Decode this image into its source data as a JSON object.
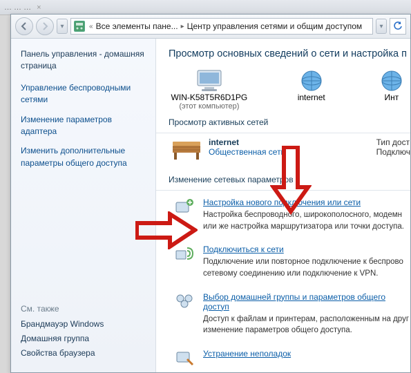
{
  "tabbar": {
    "ghost": "… … …"
  },
  "address": {
    "seg1": "Все элементы пане...",
    "seg2": "Центр управления сетями и общим доступом"
  },
  "sidebar": {
    "home": "Панель управления - домашняя страница",
    "links": [
      "Управление беспроводными сетями",
      "Изменение параметров адаптера",
      "Изменить дополнительные параметры общего доступа"
    ],
    "seealso_h": "См. также",
    "seealso": [
      "Брандмауэр Windows",
      "Домашняя группа",
      "Свойства браузера"
    ]
  },
  "main": {
    "heading": "Просмотр основных сведений о сети и настройка п",
    "net": {
      "comp_name": "WIN-K58T5R6D1PG",
      "comp_sub": "(этот компьютер)",
      "inet": "internet",
      "int2": "Инт"
    },
    "sec_active": "Просмотр активных сетей",
    "active": {
      "name": "internet",
      "type": "Общественная сеть",
      "r1": "Тип дост",
      "r2": "Подключ"
    },
    "sec_change": "Изменение сетевых параметров",
    "opts": [
      {
        "title": "Настройка нового подключения или сети",
        "desc": "Настройка беспроводного, широкополосного, модемн или же настройка маршрутизатора или точки доступа."
      },
      {
        "title": "Подключиться к сети",
        "desc": "Подключение или повторное подключение к беспрово сетевому соединению или подключение к VPN."
      },
      {
        "title": "Выбор домашней группы и параметров общего доступ",
        "desc": "Доступ к файлам и принтерам, расположенным на друг изменение параметров общего доступа."
      },
      {
        "title": "Устранение неполадок",
        "desc": ""
      }
    ]
  }
}
